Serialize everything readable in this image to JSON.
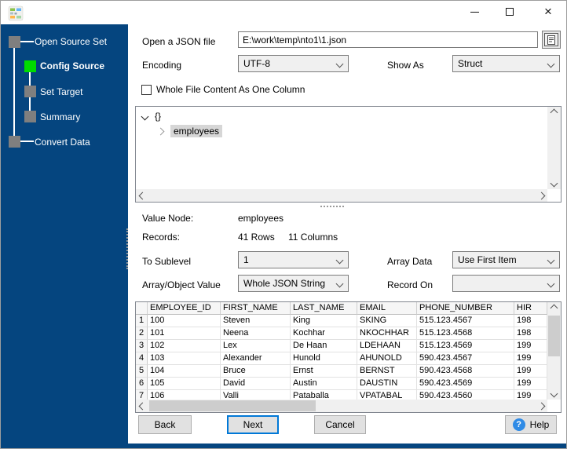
{
  "window": {
    "controls": {
      "minimize": "minimize",
      "maximize": "maximize",
      "close": "×"
    }
  },
  "sidebar": {
    "steps": [
      {
        "label": "Open Source Set",
        "state": "normal"
      },
      {
        "label": "Config Source",
        "state": "active"
      },
      {
        "label": "Set Target",
        "state": "normal"
      },
      {
        "label": "Summary",
        "state": "normal"
      },
      {
        "label": "Convert Data",
        "state": "normal"
      }
    ]
  },
  "main": {
    "file_row": {
      "label": "Open a JSON file",
      "value": "E:\\work\\temp\\nto1\\1.json"
    },
    "encoding_row": {
      "label": "Encoding",
      "value": "UTF-8"
    },
    "show_as_row": {
      "label": "Show As",
      "value": "Struct"
    },
    "one_column_checkbox": {
      "label": "Whole File Content As One Column",
      "checked": false
    },
    "tree": {
      "root_label": "{}",
      "child_label": "employees"
    },
    "value_node": {
      "label": "Value Node:",
      "value": "employees"
    },
    "records": {
      "label": "Records:",
      "rows_text": "41 Rows",
      "columns_text": "11 Columns"
    },
    "to_sublevel": {
      "label": "To Sublevel",
      "value": "1"
    },
    "array_data": {
      "label": "Array Data",
      "value": "Use First Item"
    },
    "array_object_value": {
      "label": "Array/Object Value",
      "value": "Whole JSON String"
    },
    "record_on": {
      "label": "Record On",
      "value": ""
    },
    "table": {
      "headers": [
        "",
        "EMPLOYEE_ID",
        "FIRST_NAME",
        "LAST_NAME",
        "EMAIL",
        "PHONE_NUMBER",
        "HIR"
      ],
      "rows": [
        [
          "1",
          "100",
          "Steven",
          "King",
          "SKING",
          "515.123.4567",
          "198"
        ],
        [
          "2",
          "101",
          "Neena",
          "Kochhar",
          "NKOCHHAR",
          "515.123.4568",
          "198"
        ],
        [
          "3",
          "102",
          "Lex",
          "De Haan",
          "LDEHAAN",
          "515.123.4569",
          "199"
        ],
        [
          "4",
          "103",
          "Alexander",
          "Hunold",
          "AHUNOLD",
          "590.423.4567",
          "199"
        ],
        [
          "5",
          "104",
          "Bruce",
          "Ernst",
          "BERNST",
          "590.423.4568",
          "199"
        ],
        [
          "6",
          "105",
          "David",
          "Austin",
          "DAUSTIN",
          "590.423.4569",
          "199"
        ],
        [
          "7",
          "106",
          "Valli",
          "Pataballa",
          "VPATABAL",
          "590.423.4560",
          "199"
        ]
      ]
    },
    "buttons": {
      "back": "Back",
      "next": "Next",
      "cancel": "Cancel",
      "help": "Help",
      "help_icon": "?"
    }
  },
  "colors": {
    "sidebar_blue": "#05457f",
    "active_step_green": "#00dd00",
    "inactive_step_gray": "#7f7f7f",
    "focus_blue": "#0078d7"
  }
}
